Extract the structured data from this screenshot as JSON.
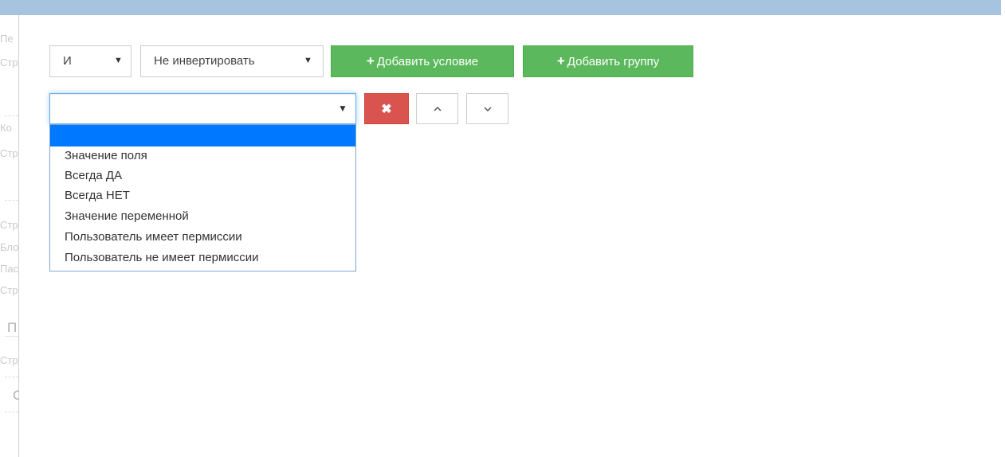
{
  "group_controls": {
    "logic_select": {
      "value": "И"
    },
    "invert_select": {
      "value": "Не инвертировать"
    },
    "add_condition_button": {
      "label": "Добавить условие"
    },
    "add_group_button": {
      "label": "Добавить группу"
    }
  },
  "condition_row": {
    "type_select": {
      "value": ""
    },
    "delete_button": {
      "icon": "close-icon"
    },
    "move_up_button": {
      "icon": "chevron-up-icon"
    },
    "move_down_button": {
      "icon": "chevron-down-icon"
    }
  },
  "condition_type_options": [
    "",
    "Значение поля",
    "Всегда ДА",
    "Всегда НЕТ",
    "Значение переменной",
    "Пользователь имеет пермиссии",
    "Пользователь не имеет пермиссии"
  ],
  "background_fragments": [
    "Пе",
    "Стр",
    "Ко",
    "Стр",
    "Стр",
    "Бло",
    "Пас",
    "Стр",
    "П",
    "Стр",
    "С"
  ],
  "colors": {
    "top_bar": "#a6c3df",
    "success": "#5cb85c",
    "danger": "#d9534f",
    "selected_option": "#0078ff",
    "focus_border": "#66afe9"
  }
}
